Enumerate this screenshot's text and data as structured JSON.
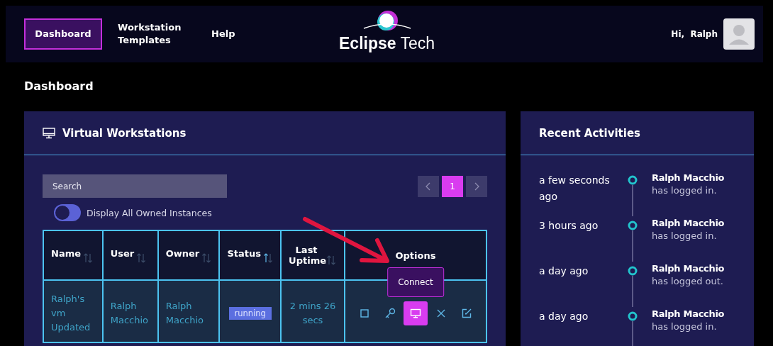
{
  "nav": {
    "items": [
      {
        "label": "Dashboard",
        "selected": true
      },
      {
        "label": "Workstation Templates",
        "selected": false
      },
      {
        "label": "Help",
        "selected": false
      }
    ],
    "logo": {
      "word_bold": "Eclipse",
      "word_light": "Tech"
    },
    "greeting": "Hi,  Ralph"
  },
  "page_title": "Dashboard",
  "workstations": {
    "title": "Virtual Workstations",
    "search": {
      "placeholder": "Search"
    },
    "pagination": {
      "pages": [
        {
          "label": "1",
          "selected": true
        }
      ]
    },
    "toggle": {
      "label": "Display All Owned Instances",
      "on": false
    },
    "columns": [
      {
        "label": "Name",
        "sorted": false
      },
      {
        "label": "User",
        "sorted": false
      },
      {
        "label": "Owner",
        "sorted": false
      },
      {
        "label": "Status",
        "sorted": true
      },
      {
        "label": "Last Uptime",
        "sorted": false
      },
      {
        "label": "Options",
        "sortable": false
      }
    ],
    "rows": [
      {
        "name": "Ralph's vm Updated",
        "user": "Ralph Macchio",
        "owner": "Ralph Macchio",
        "status": "running",
        "uptime": "2 mins 26 secs",
        "actions": [
          {
            "kind": "stop",
            "highlighted": false
          },
          {
            "kind": "key",
            "highlighted": false
          },
          {
            "kind": "connect",
            "highlighted": true,
            "tooltip": "Connect"
          },
          {
            "kind": "delete",
            "highlighted": false
          },
          {
            "kind": "edit",
            "highlighted": false
          }
        ]
      }
    ]
  },
  "activities": {
    "title": "Recent Activities",
    "items": [
      {
        "time": "a few seconds ago",
        "user": "Ralph Macchio",
        "action": "has logged in."
      },
      {
        "time": "3 hours ago",
        "user": "Ralph Macchio",
        "action": "has logged in."
      },
      {
        "time": "a day ago",
        "user": "Ralph Macchio",
        "action": "has logged out."
      },
      {
        "time": "a day ago",
        "user": "Ralph Macchio",
        "action": "has logged in."
      }
    ]
  }
}
